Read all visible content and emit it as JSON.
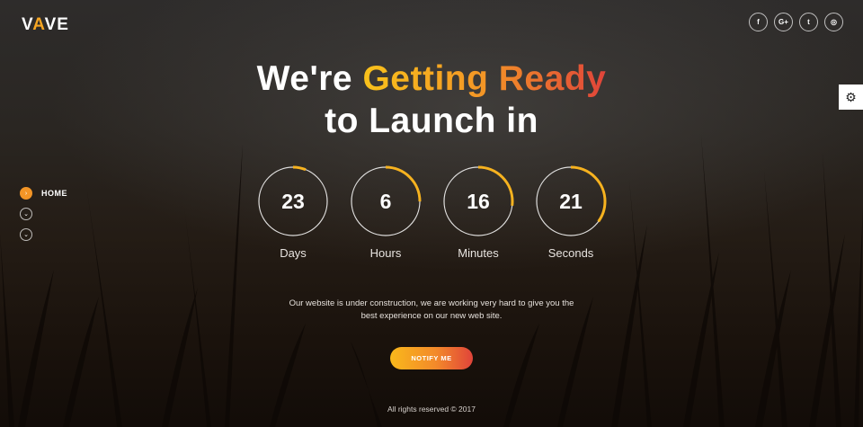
{
  "logo": {
    "part1": "V",
    "accent": "A",
    "part2": "VE"
  },
  "social": [
    {
      "name": "facebook",
      "glyph": "f"
    },
    {
      "name": "google-plus",
      "glyph": "G+"
    },
    {
      "name": "twitter",
      "glyph": "t"
    },
    {
      "name": "instagram",
      "glyph": "◎"
    }
  ],
  "settings": {
    "icon": "gear-icon",
    "glyph": "⚙"
  },
  "headline": {
    "line1_white": "We're",
    "line1_accent": "Getting Ready",
    "line2": "to Launch in"
  },
  "nav": [
    {
      "label": "HOME",
      "glyph": "›",
      "active": true
    },
    {
      "label": "",
      "glyph": "⌄",
      "active": false
    },
    {
      "label": "",
      "glyph": "⌄",
      "active": false
    }
  ],
  "countdown": [
    {
      "value": "23",
      "label": "Days",
      "progress": 0.06
    },
    {
      "value": "6",
      "label": "Hours",
      "progress": 0.25
    },
    {
      "value": "16",
      "label": "Minutes",
      "progress": 0.27
    },
    {
      "value": "21",
      "label": "Seconds",
      "progress": 0.35
    }
  ],
  "description": "Our website is under construction, we are working very hard to give you the best experience on our new web site.",
  "notify_button": "NOTIFY ME",
  "footer": "All rights reserved © 2017",
  "colors": {
    "accent_yellow": "#f9c21b",
    "accent_orange": "#f39526",
    "accent_red": "#e0443a",
    "ring_progress": "#f6b21f"
  }
}
